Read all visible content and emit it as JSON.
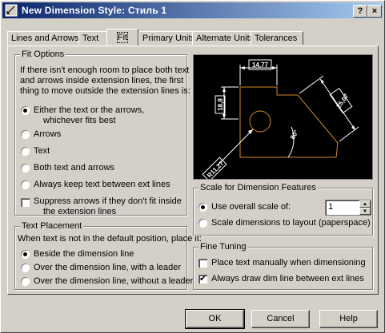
{
  "window": {
    "title": "New Dimension Style: Стиль 1",
    "help_btn": "?",
    "close_btn": "×"
  },
  "tabs": [
    {
      "label": "Lines and Arrows"
    },
    {
      "label": "Text"
    },
    {
      "label": "Fit"
    },
    {
      "label": "Primary Units"
    },
    {
      "label": "Alternate Units"
    },
    {
      "label": "Tolerances"
    }
  ],
  "fit_options": {
    "legend": "Fit Options",
    "description_lines": [
      "If there isn't enough room to place both text",
      "and arrows inside extension lines, the first",
      "thing to move outside the extension lines is:"
    ],
    "options": [
      {
        "label": "Either the text or the arrows,",
        "label2": "whichever fits best",
        "selected": true
      },
      {
        "label": "Arrows",
        "selected": false
      },
      {
        "label": "Text",
        "selected": false
      },
      {
        "label": "Both text and arrows",
        "selected": false
      },
      {
        "label": "Always keep text between ext lines",
        "selected": false
      }
    ],
    "suppress": {
      "label": "Suppress arrows if they don't fit inside",
      "label2": "the extension lines",
      "checked": false
    }
  },
  "text_placement": {
    "legend": "Text Placement",
    "description": "When text is not in the default position, place it:",
    "options": [
      {
        "label": "Beside the dimension line",
        "selected": true
      },
      {
        "label": "Over the dimension line, with a leader",
        "selected": false
      },
      {
        "label": "Over the dimension line, without a leader",
        "selected": false
      }
    ]
  },
  "preview": {
    "dims": [
      "14,77",
      "18,8",
      "25,07",
      "R11,27",
      "80°"
    ],
    "colors": {
      "bg": "#000000",
      "geometry": "#d08a2c",
      "dim": "#ffffff",
      "text": "#ffffff"
    }
  },
  "scale": {
    "legend": "Scale for Dimension Features",
    "overall": {
      "label": "Use overall scale of:",
      "selected": true,
      "value": "1"
    },
    "layout": {
      "label": "Scale dimensions to layout (paperspace)",
      "selected": false
    }
  },
  "fine_tuning": {
    "legend": "Fine Tuning",
    "manual": {
      "label": "Place text manually when dimensioning",
      "checked": false
    },
    "always": {
      "label": "Always draw dim line between ext lines",
      "checked": true
    }
  },
  "buttons": {
    "ok": "OK",
    "cancel": "Cancel",
    "help": "Help"
  },
  "accent": "#0a246a"
}
